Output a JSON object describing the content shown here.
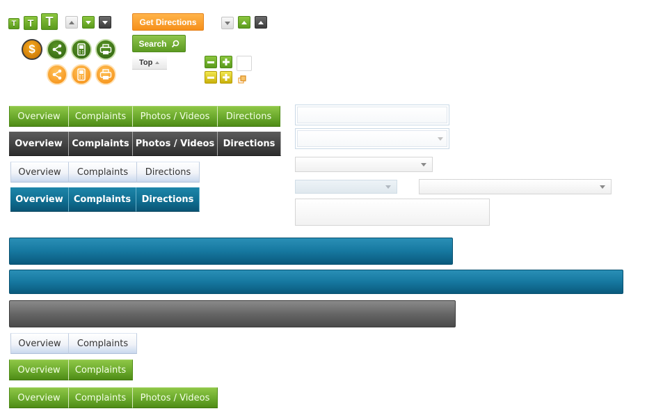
{
  "text_size": {
    "small": "T",
    "medium": "T",
    "large": "T"
  },
  "icons": {
    "row1": [
      "dollar-icon",
      "share-icon",
      "mobile-phone-icon",
      "print-icon"
    ],
    "row2": [
      "share-icon",
      "mobile-phone-icon",
      "print-icon"
    ],
    "dollar_glyph": "$"
  },
  "buttons": {
    "get_directions": "Get Directions",
    "search": "Search",
    "top": "Top"
  },
  "tabs": {
    "green_row_1": [
      "Overview",
      "Complaints",
      "Photos / Videos",
      "Directions"
    ],
    "dark_row": [
      "Overview",
      "Complaints",
      "Photos / Videos",
      "Directions"
    ],
    "light_row_1": [
      "Overview",
      "Complaints",
      "Directions"
    ],
    "teal_row": [
      "Overview",
      "Complaints",
      "Directions"
    ],
    "light_row_2": [
      "Overview",
      "Complaints"
    ],
    "green_row_2": [
      "Overview",
      "Complaints"
    ],
    "green_row_3": [
      "Overview",
      "Complaints",
      "Photos / Videos"
    ]
  },
  "colors": {
    "green": "#6aa92c",
    "dark": "#3c3c3c",
    "teal": "#0f6c8f",
    "orange": "#f6901a",
    "yellow": "#d9c81a",
    "light_blue": "#c9d8ee"
  }
}
